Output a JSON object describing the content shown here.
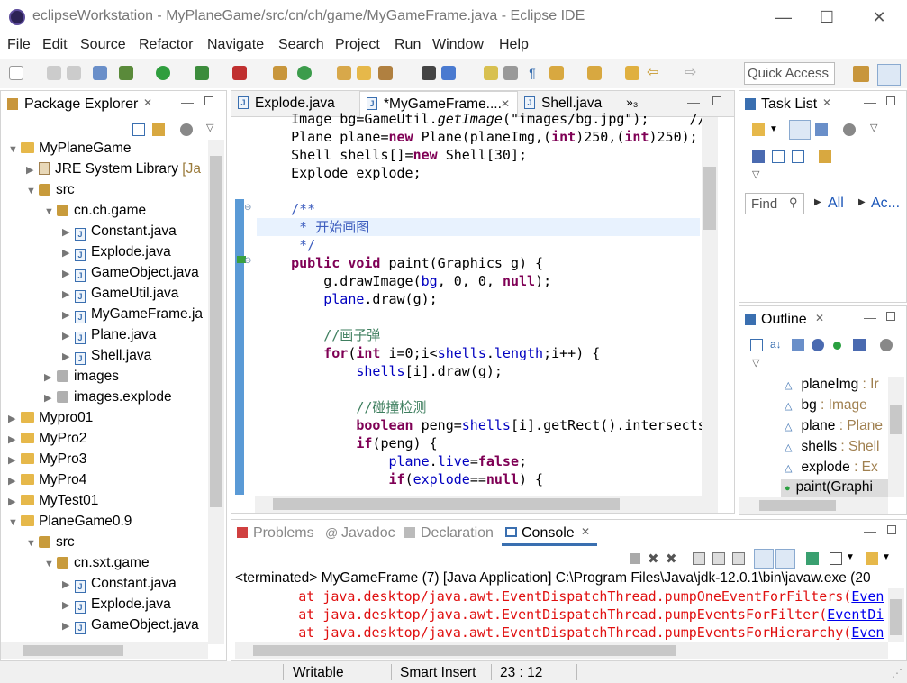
{
  "window": {
    "title": "eclipseWorkstation - MyPlaneGame/src/cn/ch/game/MyGameFrame.java - Eclipse IDE",
    "minimize": "—",
    "maximize": "☐",
    "close": "✕"
  },
  "menu": [
    "File",
    "Edit",
    "Source",
    "Refactor",
    "Navigate",
    "Search",
    "Project",
    "Run",
    "Window",
    "Help"
  ],
  "quick_access": "Quick Access",
  "package_explorer": {
    "tab": "Package Explorer",
    "tree": [
      {
        "label": "MyPlaneGame"
      },
      {
        "label": "JRE System Library",
        "suffix": " [Ja"
      },
      {
        "label": "src"
      },
      {
        "label": "cn.ch.game"
      },
      {
        "label": "Constant.java"
      },
      {
        "label": "Explode.java"
      },
      {
        "label": "GameObject.java"
      },
      {
        "label": "GameUtil.java"
      },
      {
        "label": "MyGameFrame.ja"
      },
      {
        "label": "Plane.java"
      },
      {
        "label": "Shell.java"
      },
      {
        "label": "images"
      },
      {
        "label": "images.explode"
      },
      {
        "label": "Mypro01"
      },
      {
        "label": "MyPro2"
      },
      {
        "label": "MyPro3"
      },
      {
        "label": "MyPro4"
      },
      {
        "label": "MyTest01"
      },
      {
        "label": "PlaneGame0.9"
      },
      {
        "label": "src"
      },
      {
        "label": "cn.sxt.game"
      },
      {
        "label": "Constant.java"
      },
      {
        "label": "Explode.java"
      },
      {
        "label": "GameObject.java"
      }
    ]
  },
  "editor": {
    "tabs": [
      "Explode.java",
      "*MyGameFrame....",
      "Shell.java"
    ],
    "overflow": "»₃",
    "lines": [
      "    Image bg=GameUtil.getImage(\"images/bg.jpg\");     //",
      "    Plane plane=new Plane(planeImg,(int)250,(int)250);",
      "    Shell shells[]=new Shell[30];",
      "    Explode explode;",
      "",
      "    /**",
      "     * 开始画图",
      "     */",
      "    public void paint(Graphics g) {",
      "        g.drawImage(bg, 0, 0, null);",
      "        plane.draw(g);",
      "",
      "        //画子弹",
      "        for(int i=0;i<shells.length;i++) {",
      "            shells[i].draw(g);",
      "",
      "            //碰撞检测",
      "            boolean peng=shells[i].getRect().intersects",
      "            if(peng) {",
      "                plane.live=false;",
      "                if(explode==null) {"
    ]
  },
  "task_list": {
    "tab": "Task List",
    "find_placeholder": "Find",
    "all": "All",
    "activate": "Ac..."
  },
  "outline": {
    "tab": "Outline",
    "items": [
      {
        "name": "planeImg",
        "type": " : Ir"
      },
      {
        "name": "bg",
        "type": " : Image"
      },
      {
        "name": "plane",
        "type": " : Plane"
      },
      {
        "name": "shells",
        "type": " : Shell"
      },
      {
        "name": "explode",
        "type": " : Ex"
      },
      {
        "name": "paint(Graphi",
        "type": ""
      }
    ]
  },
  "bottom": {
    "tabs": [
      "Problems",
      "Javadoc",
      "Declaration",
      "Console"
    ],
    "terminated": "<terminated> MyGameFrame (7) [Java Application] C:\\Program Files\\Java\\jdk-12.0.1\\bin\\javaw.exe (20",
    "console_lines": [
      {
        "prefix": "        at java.desktop/java.awt.EventDispatchThread.pumpOneEventForFilters(",
        "link": "Even"
      },
      {
        "prefix": "        at java.desktop/java.awt.EventDispatchThread.pumpEventsForFilter(",
        "link": "EventDi"
      },
      {
        "prefix": "        at java.desktop/java.awt.EventDispatchThread.pumpEventsForHierarchy(",
        "link": "Even"
      }
    ]
  },
  "status": {
    "writable": "Writable",
    "insert": "Smart Insert",
    "position": "23 : 12"
  }
}
